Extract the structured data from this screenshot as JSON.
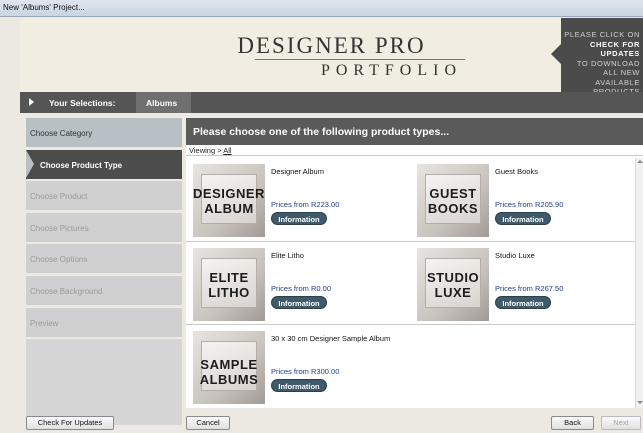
{
  "window": {
    "title": "New 'Albums' Project..."
  },
  "banner": {
    "brand_line1": "DESIGNER PRO",
    "brand_line2": "PORTFOLIO",
    "update_line1": "PLEASE CLICK ON",
    "update_line2": "CHECK FOR UPDATES",
    "update_line3": "TO DOWNLOAD ALL NEW",
    "update_line4": "AVAILABLE PRODUCTS"
  },
  "selections": {
    "label": "Your Selections:",
    "crumb": "Albums"
  },
  "sidebar": {
    "steps": [
      {
        "label": "Choose Category",
        "state": "done"
      },
      {
        "label": "Choose Product Type",
        "state": "active"
      },
      {
        "label": "Choose Product",
        "state": "pending"
      },
      {
        "label": "Choose Pictures",
        "state": "pending"
      },
      {
        "label": "Choose Options",
        "state": "pending"
      },
      {
        "label": "Choose Background",
        "state": "pending"
      },
      {
        "label": "Preview",
        "state": "pending"
      }
    ]
  },
  "main": {
    "heading": "Please choose one of the following product types...",
    "viewing_label": "Viewing >",
    "viewing_link": "All",
    "products": [
      {
        "name": "Designer Album",
        "price": "Prices from R223.00",
        "thumb_line1": "DESIGNER",
        "thumb_line2": "ALBUM",
        "button": "Information"
      },
      {
        "name": "Guest Books",
        "price": "Prices from R205.90",
        "thumb_line1": "GUEST",
        "thumb_line2": "BOOKS",
        "button": "Information"
      },
      {
        "name": "Elite Litho",
        "price": "Prices from R0.00",
        "thumb_line1": "ELITE",
        "thumb_line2": "LITHO",
        "button": "Information"
      },
      {
        "name": "Studio Luxe",
        "price": "Prices from R267.50",
        "thumb_line1": "STUDIO",
        "thumb_line2": "LUXE",
        "button": "Information"
      },
      {
        "name": "30 x 30 cm Designer Sample Album",
        "price": "Prices from R300.00",
        "thumb_line1": "SAMPLE",
        "thumb_line2": "ALBUMS",
        "button": "Information"
      }
    ]
  },
  "footer": {
    "check_updates": "Check For Updates",
    "cancel": "Cancel",
    "back": "Back",
    "next": "Next"
  }
}
